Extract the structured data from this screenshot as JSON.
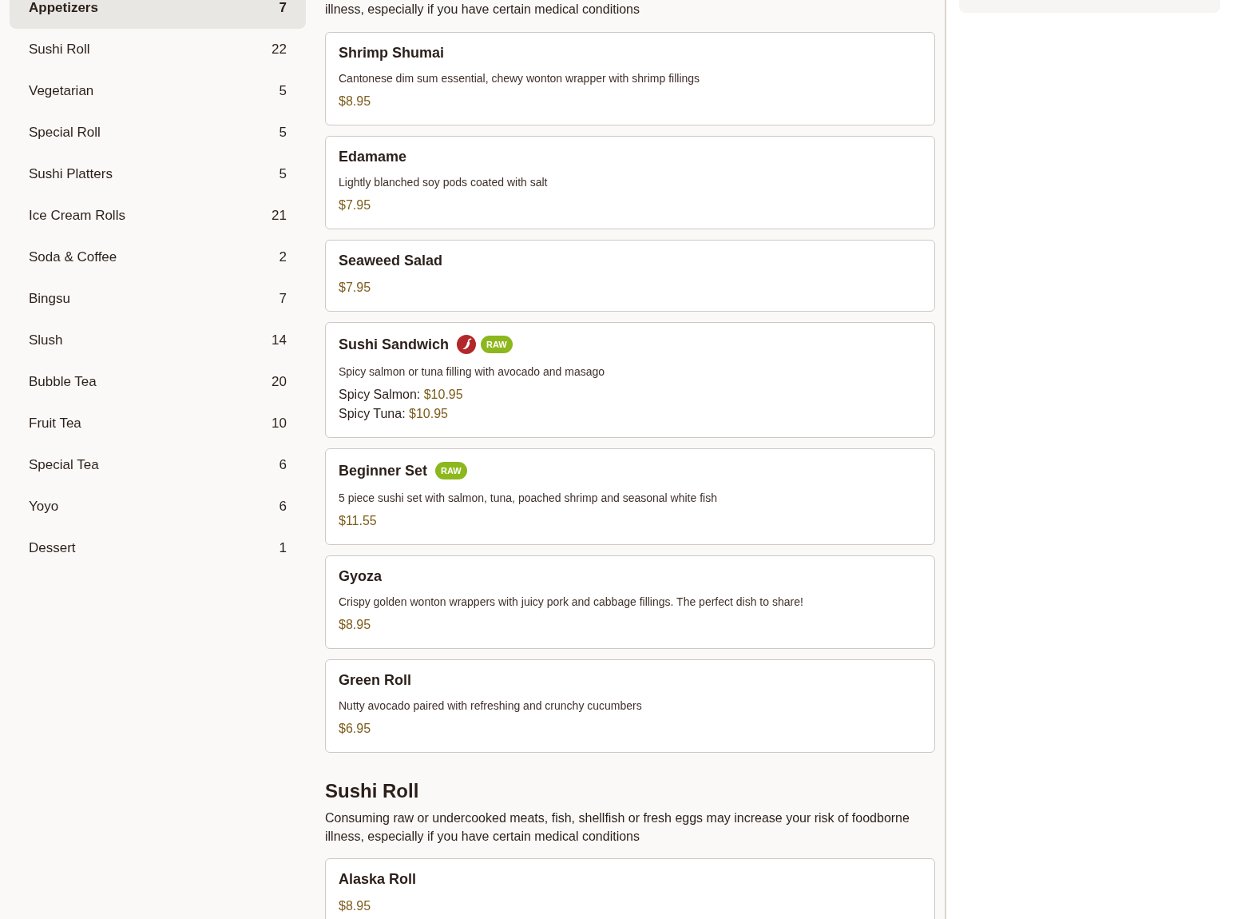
{
  "sidebar": {
    "categories": [
      {
        "label": "Appetizers",
        "count": "7",
        "selected": true
      },
      {
        "label": "Sushi Roll",
        "count": "22",
        "selected": false
      },
      {
        "label": "Vegetarian",
        "count": "5",
        "selected": false
      },
      {
        "label": "Special Roll",
        "count": "5",
        "selected": false
      },
      {
        "label": "Sushi Platters",
        "count": "5",
        "selected": false
      },
      {
        "label": "Ice Cream Rolls",
        "count": "21",
        "selected": false
      },
      {
        "label": "Soda & Coffee",
        "count": "2",
        "selected": false
      },
      {
        "label": "Bingsu",
        "count": "7",
        "selected": false
      },
      {
        "label": "Slush",
        "count": "14",
        "selected": false
      },
      {
        "label": "Bubble Tea",
        "count": "20",
        "selected": false
      },
      {
        "label": "Fruit Tea",
        "count": "10",
        "selected": false
      },
      {
        "label": "Special Tea",
        "count": "6",
        "selected": false
      },
      {
        "label": "Yoyo",
        "count": "6",
        "selected": false
      },
      {
        "label": "Dessert",
        "count": "1",
        "selected": false
      }
    ]
  },
  "menu": {
    "sections": [
      {
        "notice": "illness, especially if you have certain medical conditions",
        "items": [
          {
            "name": "Shrimp Shumai",
            "description": "Cantonese dim sum essential, chewy wonton wrapper with shrimp fillings",
            "prices": [
              {
                "amount": "$8.95"
              }
            ]
          },
          {
            "name": "Edamame",
            "description": "Lightly blanched soy pods coated with salt",
            "prices": [
              {
                "amount": "$7.95"
              }
            ]
          },
          {
            "name": "Seaweed Salad",
            "prices": [
              {
                "amount": "$7.95"
              }
            ]
          },
          {
            "name": "Sushi Sandwich",
            "tags": [
              {
                "kind": "spicy"
              },
              {
                "kind": "raw",
                "label": "RAW"
              }
            ],
            "description": "Spicy salmon or tuna filling with avocado and masago",
            "prices": [
              {
                "label": "Spicy Salmon:",
                "amount": "$10.95"
              },
              {
                "label": "Spicy Tuna:",
                "amount": "$10.95"
              }
            ]
          },
          {
            "name": "Beginner Set",
            "tags": [
              {
                "kind": "raw",
                "label": "RAW"
              }
            ],
            "description": "5 piece sushi set with salmon, tuna, poached shrimp and seasonal white fish",
            "prices": [
              {
                "amount": "$11.55"
              }
            ]
          },
          {
            "name": "Gyoza",
            "description": "Crispy golden wonton wrappers with juicy pork and cabbage fillings. The perfect dish to share!",
            "prices": [
              {
                "amount": "$8.95"
              }
            ]
          },
          {
            "name": "Green Roll",
            "description": "Nutty avocado paired with refreshing and crunchy cucumbers",
            "prices": [
              {
                "amount": "$6.95"
              }
            ]
          }
        ]
      },
      {
        "title": "Sushi Roll",
        "notice": "Consuming raw or undercooked meats, fish, shellfish or fresh eggs may increase your risk of foodborne illness, especially if you have certain medical conditions",
        "items": [
          {
            "name": "Alaska Roll",
            "prices": [
              {
                "amount": "$8.95"
              }
            ]
          }
        ]
      }
    ]
  }
}
